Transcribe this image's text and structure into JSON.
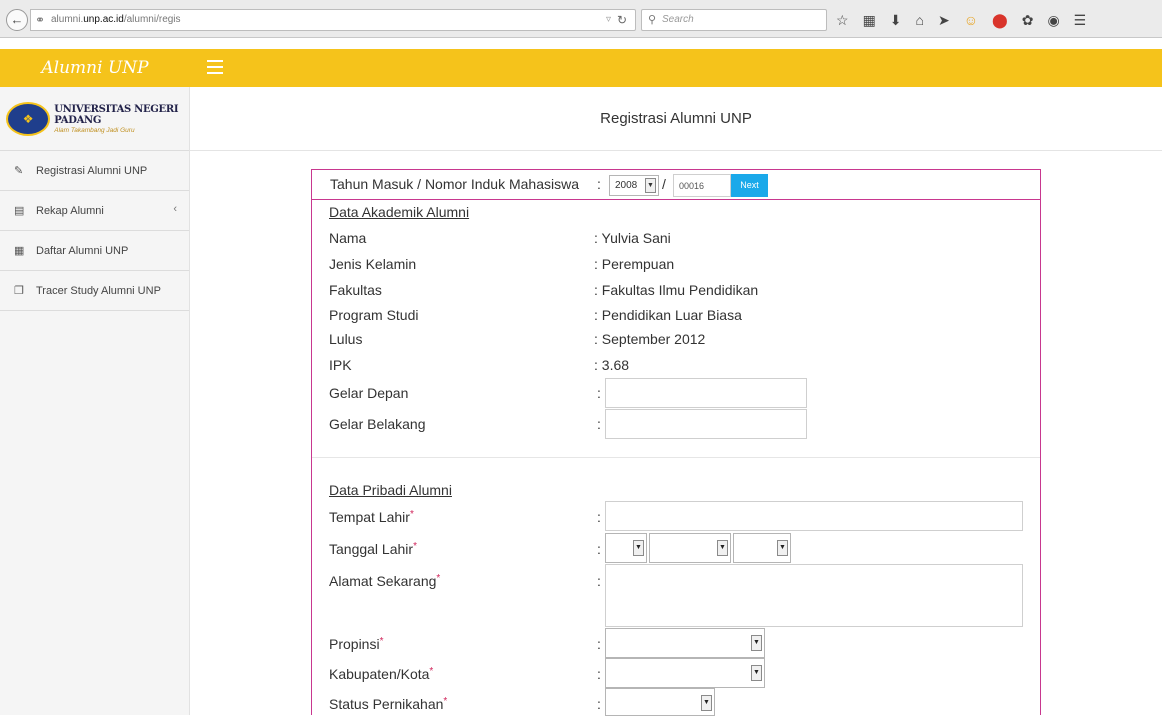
{
  "browser": {
    "url_plain": "alumni.",
    "url_domain": "unp.ac.id",
    "url_path": "/alumni/regis",
    "search_placeholder": "Search"
  },
  "header": {
    "brand": "Alumni UNP"
  },
  "sidebar": {
    "logo_name": "UNIVERSITAS NEGERI PADANG",
    "logo_tagline": "Alam Takambang Jadi Guru",
    "items": [
      {
        "label": "Registrasi Alumni UNP",
        "icon": "edit-icon"
      },
      {
        "label": "Rekap Alumni",
        "icon": "bar-chart-icon"
      },
      {
        "label": "Daftar Alumni UNP",
        "icon": "table-icon"
      },
      {
        "label": "Tracer Study Alumni UNP",
        "icon": "files-icon"
      }
    ]
  },
  "page": {
    "title": "Registrasi Alumni UNP"
  },
  "nim_row": {
    "label": "Tahun Masuk / Nomor Induk Mahasiswa",
    "year": "2008",
    "nim": "00016",
    "next_label": "Next"
  },
  "akademik": {
    "section_title": "Data Akademik Alumni",
    "fields": [
      {
        "label": "Nama",
        "value": ": Yulvia Sani"
      },
      {
        "label": "Jenis Kelamin",
        "value": ": Perempuan"
      },
      {
        "label": "Fakultas",
        "value": ": Fakultas Ilmu Pendidikan"
      },
      {
        "label": "Program Studi",
        "value": ": Pendidikan Luar Biasa"
      },
      {
        "label": "Lulus",
        "value": ": September 2012"
      },
      {
        "label": "IPK",
        "value": ": 3.68"
      }
    ],
    "gelar_depan_label": "Gelar Depan",
    "gelar_belakang_label": "Gelar Belakang"
  },
  "pribadi": {
    "section_title": "Data Pribadi Alumni",
    "tempat_lahir_label": "Tempat Lahir",
    "tanggal_lahir_label": "Tanggal Lahir",
    "alamat_label": "Alamat Sekarang",
    "propinsi_label": "Propinsi",
    "kabupaten_label": "Kabupaten/Kota",
    "status_label": "Status Pernikahan"
  },
  "colors": {
    "header_bg": "#f5c31b",
    "form_border": "#c8378f",
    "next_button": "#1aa9ea",
    "required_mark": "#d0245a"
  }
}
